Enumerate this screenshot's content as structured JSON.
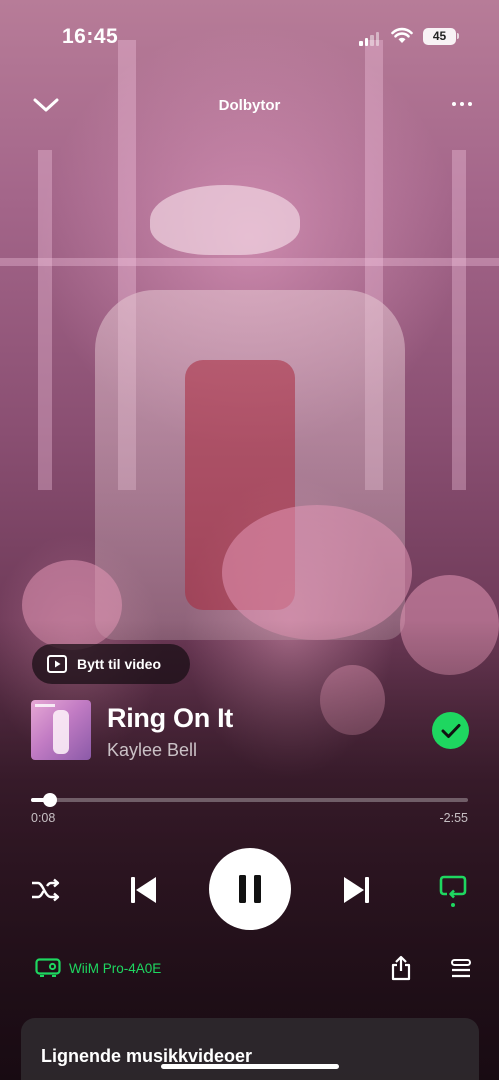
{
  "status_bar": {
    "time": "16:45",
    "battery": "45",
    "icons": [
      "cellular-signal-icon",
      "wifi-icon",
      "battery-icon"
    ]
  },
  "header": {
    "title": "Dolbytor",
    "icons": [
      "chevron-down-icon",
      "more-options-icon"
    ]
  },
  "video_toggle": {
    "label": "Bytt til video",
    "icon": "video-play-icon"
  },
  "track": {
    "title": "Ring On It",
    "artist": "Kaylee Bell",
    "liked": true
  },
  "playback": {
    "elapsed": "0:08",
    "remaining": "-2:55",
    "progress_fraction": 0.044,
    "state": "playing"
  },
  "controls": {
    "icons": [
      "shuffle-icon",
      "previous-track-icon",
      "pause-icon",
      "next-track-icon",
      "repeat-icon"
    ]
  },
  "device": {
    "name": "WiiM Pro-4A0E",
    "icon": "speaker-device-icon"
  },
  "actions": {
    "icons": [
      "share-icon",
      "queue-icon"
    ]
  },
  "related": {
    "title": "Lignende musikkvideoer"
  },
  "colors": {
    "accent": "#1ed760",
    "text": "#ffffff"
  }
}
